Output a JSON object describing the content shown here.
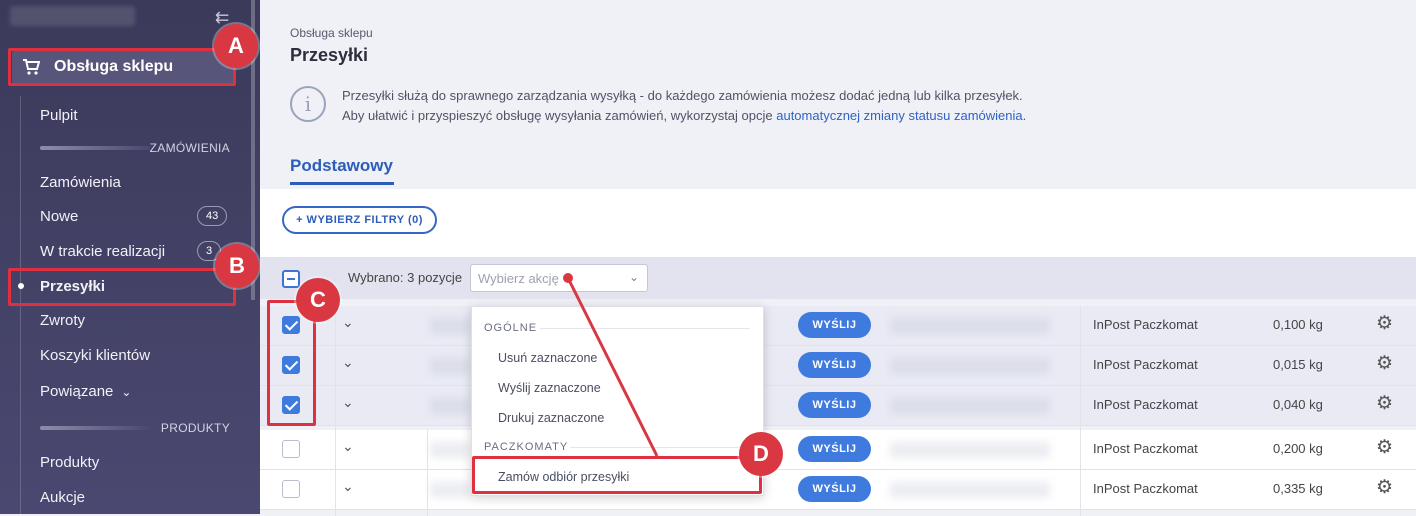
{
  "sidebar": {
    "shop_label": "Obsługa sklepu",
    "items": [
      {
        "label": "Pulpit"
      },
      {
        "label": "Zamówienia"
      },
      {
        "label": "Nowe",
        "badge": "43"
      },
      {
        "label": "W trakcie realizacji",
        "badge": "3"
      },
      {
        "label": "Przesyłki"
      },
      {
        "label": "Zwroty"
      },
      {
        "label": "Koszyki klientów"
      },
      {
        "label": "Powiązane"
      },
      {
        "label": "Produkty"
      },
      {
        "label": "Aukcje"
      }
    ],
    "section_orders": "ZAMÓWIENIA",
    "section_products": "PRODUKTY"
  },
  "page": {
    "breadcrumb": "Obsługa sklepu",
    "title": "Przesyłki",
    "info_line1": "Przesyłki służą do sprawnego zarządzania wysyłką - do każdego zamówienia możesz dodać jedną lub kilka przesyłek.",
    "info_line2_prefix": "Aby ułatwić i przyspieszyć obsługę wysyłania zamówień, wykorzystaj opcje ",
    "info_link": "automatycznej zmiany statusu zamówienia",
    "info_line2_suffix": ".",
    "tab": "Podstawowy",
    "filter_button": "+ WYBIERZ FILTRY (0)"
  },
  "action_bar": {
    "selected_text": "Wybrano: 3 pozycje",
    "select_placeholder": "Wybierz akcję"
  },
  "dropdown": {
    "group1": "OGÓLNE",
    "items1": [
      "Usuń zaznaczone",
      "Wyślij zaznaczone",
      "Drukuj zaznaczone"
    ],
    "group2": "PACZKOMATY",
    "items2": [
      "Zamów odbiór przesyłki"
    ]
  },
  "rows": [
    {
      "checked": true,
      "send": "WYŚLIJ",
      "carrier": "InPost Paczkomat",
      "weight": "0,100 kg"
    },
    {
      "checked": true,
      "send": "WYŚLIJ",
      "carrier": "InPost Paczkomat",
      "weight": "0,015 kg"
    },
    {
      "checked": true,
      "send": "WYŚLIJ",
      "carrier": "InPost Paczkomat",
      "weight": "0,040 kg"
    },
    {
      "checked": false,
      "send": "WYŚLIJ",
      "carrier": "InPost Paczkomat",
      "weight": "0,200 kg"
    },
    {
      "checked": false,
      "send": "WYŚLIJ",
      "carrier": "InPost Paczkomat",
      "weight": "0,335 kg"
    }
  ],
  "annotations": {
    "a": "A",
    "b": "B",
    "c": "C",
    "d": "D"
  },
  "colors": {
    "accent": "#3f7bde",
    "annotation": "#d93843",
    "sidebar": "#3b3a5a"
  }
}
